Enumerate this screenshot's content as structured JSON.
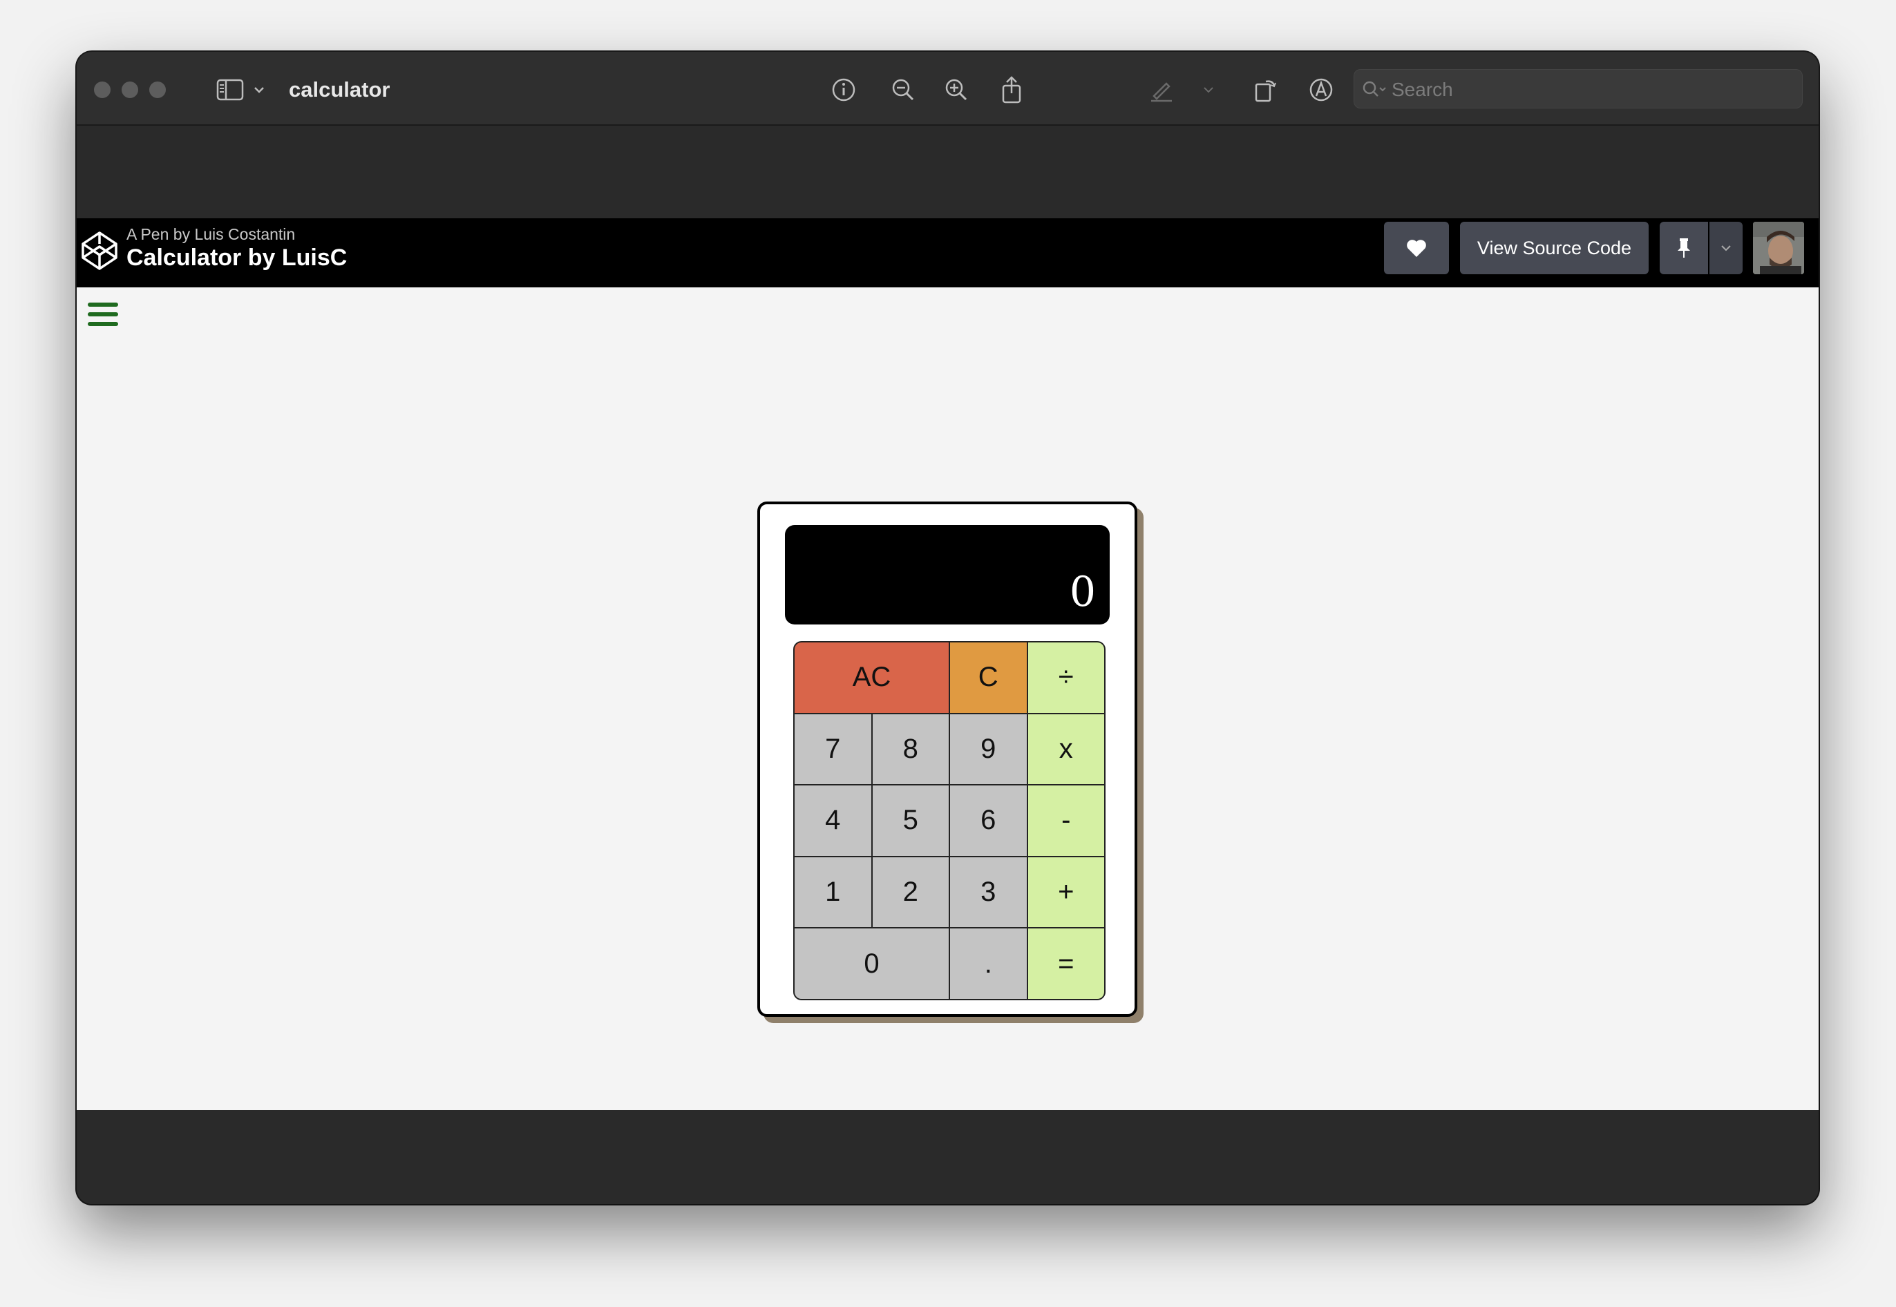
{
  "window": {
    "title": "calculator",
    "search_placeholder": "Search",
    "toolbar_icons": [
      "sidebar-icon",
      "chevron-down-icon",
      "info-icon",
      "zoom-out-icon",
      "zoom-in-icon",
      "share-icon",
      "markup-pen-icon",
      "chevron-down-icon",
      "rotate-icon",
      "annotate-icon",
      "signature-icon"
    ]
  },
  "codepen": {
    "subtitle": "A Pen by Luis Costantin",
    "title": "Calculator by LuisC",
    "view_source_label": "View Source Code",
    "icons": [
      "codepen-logo-icon",
      "heart-icon",
      "pin-icon",
      "chevron-down-icon"
    ]
  },
  "calculator": {
    "display_value": "0",
    "keys": {
      "ac": "AC",
      "c": "C",
      "divide": "÷",
      "seven": "7",
      "eight": "8",
      "nine": "9",
      "multiply": "x",
      "four": "4",
      "five": "5",
      "six": "6",
      "minus": "-",
      "one": "1",
      "two": "2",
      "three": "3",
      "plus": "+",
      "zero": "0",
      "dot": ".",
      "equals": "="
    },
    "colors": {
      "clear_all": "#d9654a",
      "clear": "#e09a41",
      "operator": "#d5f0a3",
      "number": "#c4c4c4",
      "display": "#000000"
    }
  }
}
